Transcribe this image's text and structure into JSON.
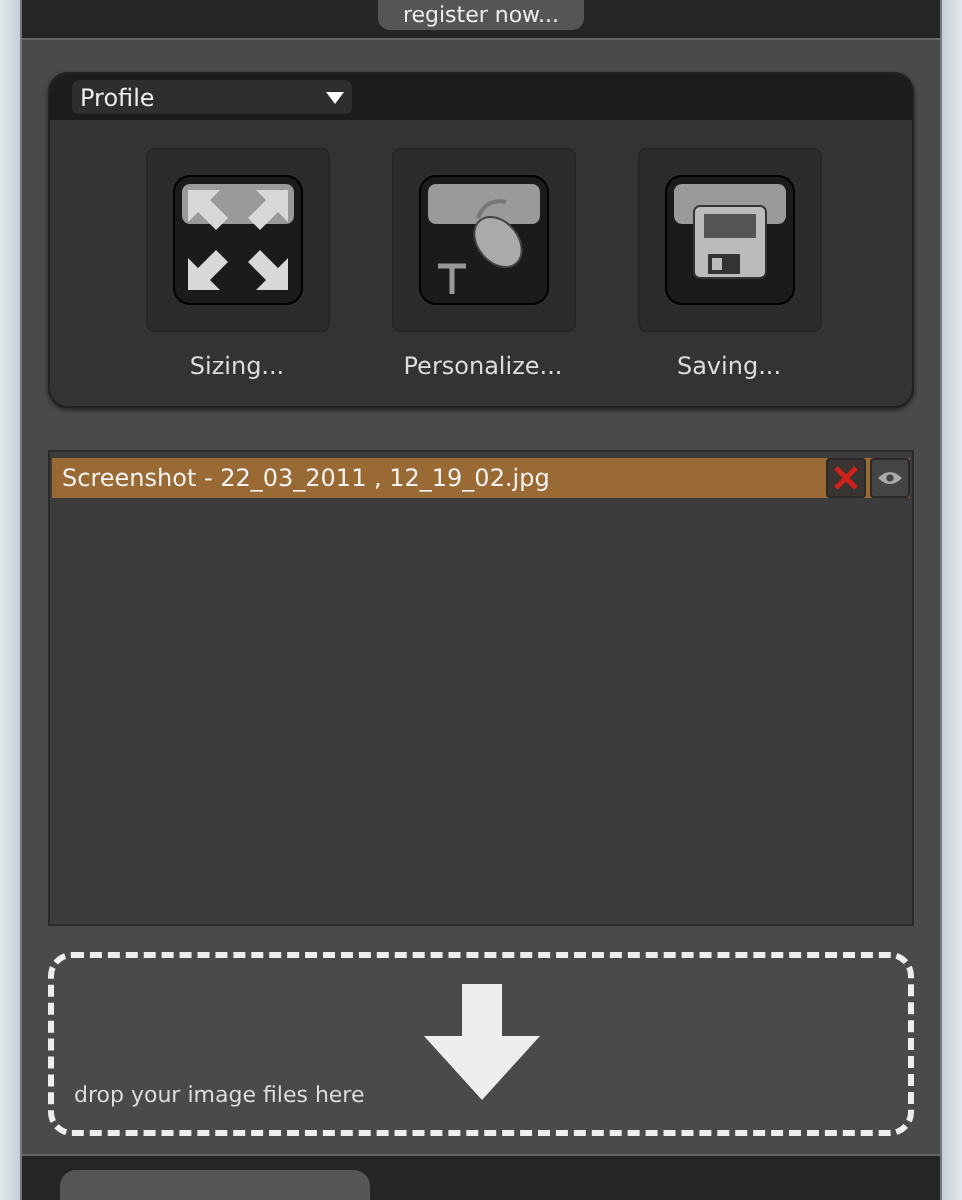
{
  "header": {
    "register_button": "register now..."
  },
  "profile": {
    "dropdown": "Profile",
    "actions": [
      {
        "kind": "sizing",
        "label": "Sizing..."
      },
      {
        "kind": "personalize",
        "label": "Personalize..."
      },
      {
        "kind": "saving",
        "label": "Saving..."
      }
    ]
  },
  "files": [
    {
      "name": "Screenshot - 22_03_2011 , 12_19_02.jpg",
      "selected": true
    }
  ],
  "drop_zone": {
    "hint": "drop your image files here"
  }
}
